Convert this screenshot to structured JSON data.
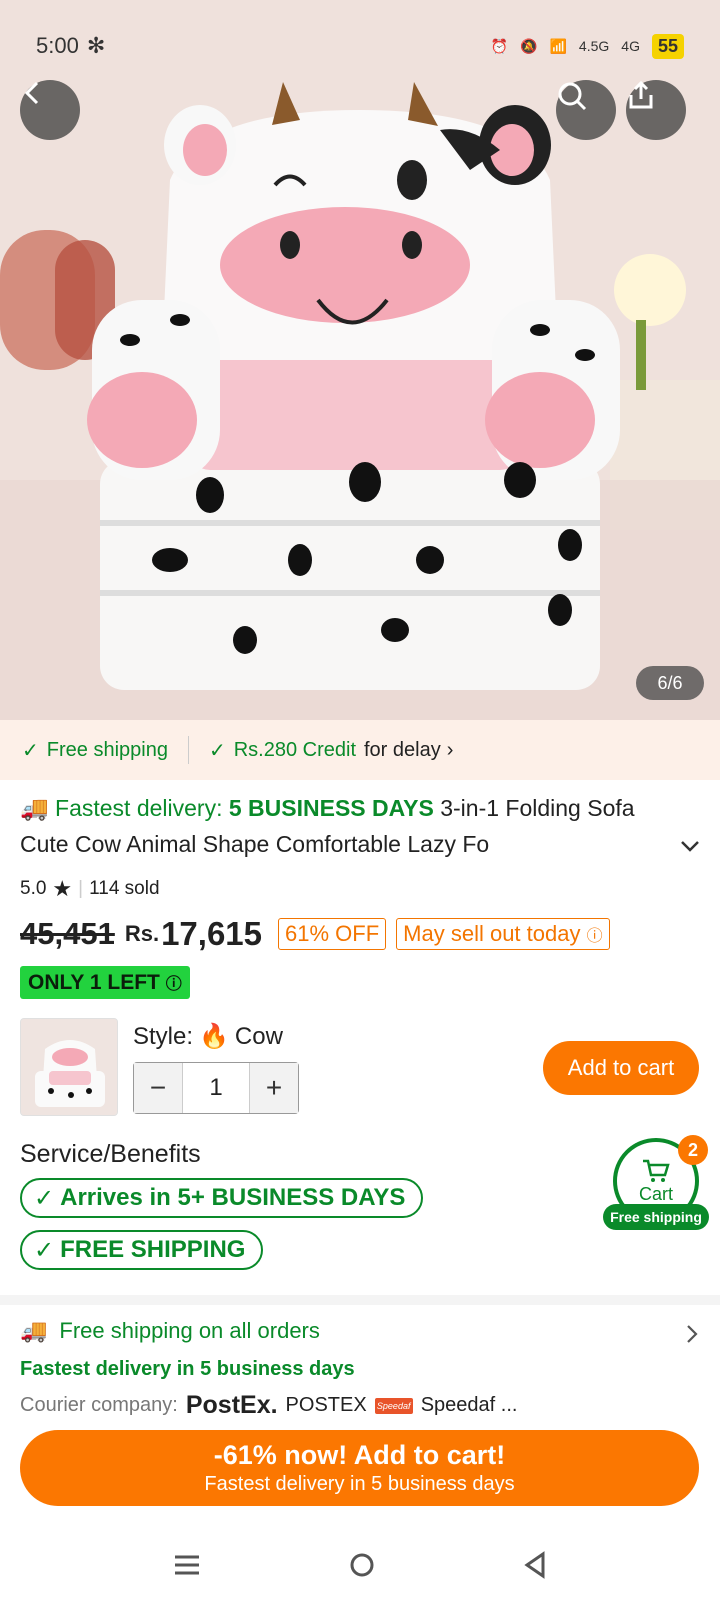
{
  "status": {
    "time": "5:00",
    "net1": "4.5G",
    "net2": "4G",
    "battery": "55"
  },
  "gallery": {
    "counter": "6/6"
  },
  "strip": {
    "free_shipping": "Free shipping",
    "credit": "Rs.280 Credit",
    "credit_suffix": "for delay"
  },
  "product": {
    "title_green_prefix": "Fastest delivery: ",
    "title_green_bold": "5 BUSINESS DAYS",
    "title_rest": " 3-in-1 Folding Sofa Cute Cow Animal Shape Comfortable Lazy Fo",
    "rating": "5.0",
    "sold": "114 sold",
    "old_price": "45,451",
    "currency": "Rs.",
    "price": "17,615",
    "discount": "61% OFF",
    "sell_out": "May sell out today",
    "only_left": "ONLY 1 LEFT"
  },
  "variant": {
    "style_label": "Style:",
    "style_value": "Cow",
    "quantity": "1",
    "add_to_cart": "Add to cart"
  },
  "service": {
    "title": "Service/Benefits",
    "badge1": "Arrives in 5+ BUSINESS DAYS",
    "badge2": "FREE SHIPPING"
  },
  "cart_float": {
    "label": "Cart",
    "count": "2",
    "tag": "Free shipping"
  },
  "shipinfo": {
    "line1": "Free shipping on all orders",
    "line2": "Fastest delivery in 5 business days",
    "courier_label": "Courier company:",
    "logo1": "PostEx.",
    "courier1": "POSTEX",
    "logo2": "Speedaf",
    "courier2": "Speedaf ..."
  },
  "bottom_cta": {
    "line1": "-61% now! Add to cart!",
    "line2": "Fastest delivery in 5 business days"
  },
  "colors": {
    "accent": "#fb7701",
    "green": "#0a8a2a",
    "only_left_bg": "#22d23e"
  }
}
